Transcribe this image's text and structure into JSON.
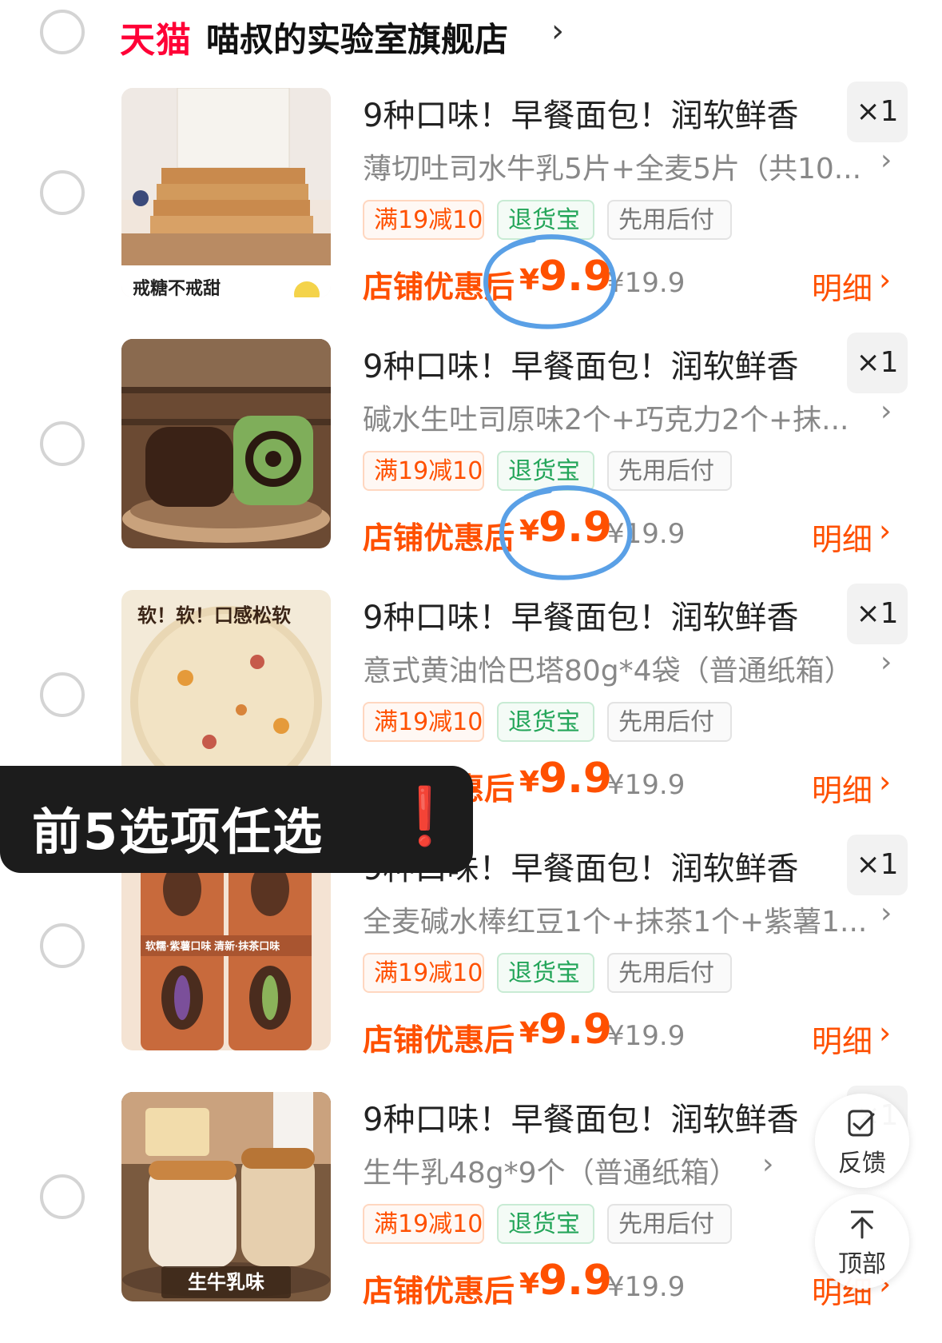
{
  "shop": {
    "logo": "天猫",
    "name": "喵叔的实验室旗舰店",
    "chevron": "›"
  },
  "items": [
    {
      "title": "9种口味！早餐面包！润软鲜香",
      "qty": "×1",
      "spec": "薄切吐司水牛乳5片+全麦5片（共10...",
      "tag_promo": "满19减10",
      "tag_return": "退货宝",
      "tag_pay": "先用后付",
      "price_label": "店铺优惠后",
      "currency": "¥",
      "price": "9.9",
      "orig_price": "¥19.9",
      "detail": "明细",
      "thumb_caption": "戒糖不戒甜"
    },
    {
      "title": "9种口味！早餐面包！润软鲜香",
      "qty": "×1",
      "spec": "碱水生吐司原味2个+巧克力2个+抹...",
      "tag_promo": "满19减10",
      "tag_return": "退货宝",
      "tag_pay": "先用后付",
      "price_label": "店铺优惠后",
      "currency": "¥",
      "price": "9.9",
      "orig_price": "¥19.9",
      "detail": "明细",
      "thumb_caption": ""
    },
    {
      "title": "9种口味！早餐面包！润软鲜香",
      "qty": "×1",
      "spec": "意式黄油恰巴塔80g*4袋（普通纸箱）",
      "tag_promo": "满19减10",
      "tag_return": "退货宝",
      "tag_pay": "先用后付",
      "price_label": "店铺优惠后",
      "currency": "¥",
      "price": "9.9",
      "orig_price": "¥19.9",
      "detail": "明细",
      "thumb_caption": "软！软！口感松软"
    },
    {
      "title": "9种口味！早餐面包！润软鲜香",
      "qty": "×1",
      "spec": "全麦碱水棒红豆1个+抹茶1个+紫薯1...",
      "tag_promo": "满19减10",
      "tag_return": "退货宝",
      "tag_pay": "先用后付",
      "price_label": "店铺优惠后",
      "currency": "¥",
      "price": "9.9",
      "orig_price": "¥19.9",
      "detail": "明细",
      "thumb_caption": "软糯·紫薯口味 清新·抹茶口味"
    },
    {
      "title": "9种口味！早餐面包！润软鲜香",
      "qty": "×1",
      "spec": "生牛乳48g*9个（普通纸箱）",
      "tag_promo": "满19减10",
      "tag_return": "退货宝",
      "tag_pay": "先用后付",
      "price_label": "店铺优惠后",
      "currency": "¥",
      "price": "9.9",
      "orig_price": "¥19.9",
      "detail": "明细",
      "thumb_caption": "生牛乳味"
    }
  ],
  "overlay": {
    "text": "前5选项任选",
    "mark": "❗"
  },
  "floating": {
    "feedback_label": "反馈",
    "top_label": "顶部"
  },
  "colors": {
    "accent": "#ff5000",
    "tmall_red": "#ff0036",
    "return_green": "#23a559",
    "annotation_blue": "#5aa0e6"
  }
}
